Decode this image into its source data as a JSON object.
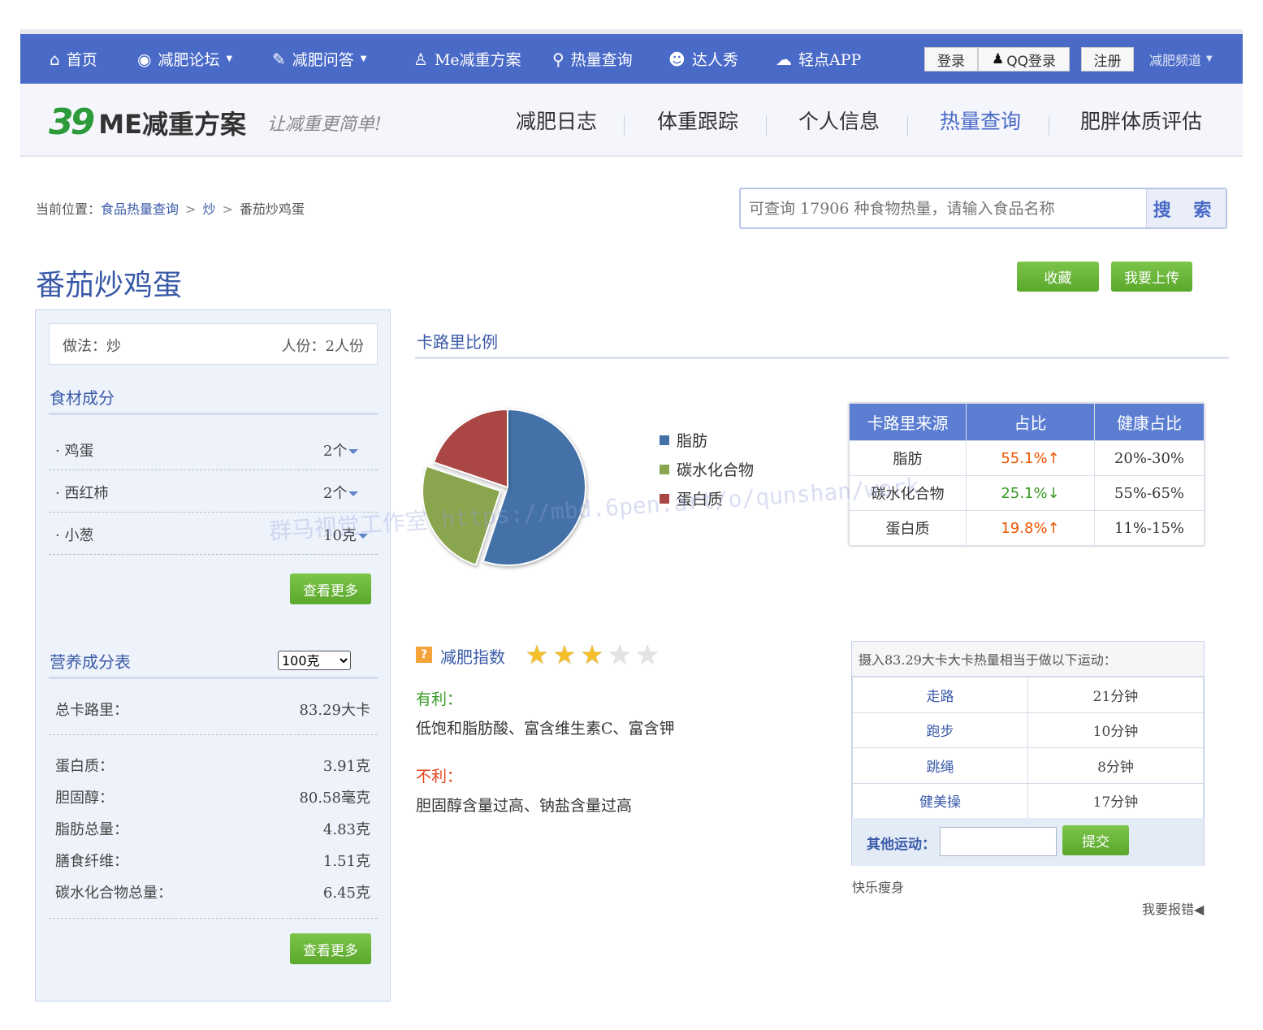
{
  "topnav": {
    "items": [
      {
        "label": "首页",
        "icon": "home-icon"
      },
      {
        "label": "减肥论坛",
        "icon": "forum-icon"
      },
      {
        "label": "减肥问答",
        "icon": "qa-icon"
      },
      {
        "label": "Me减重方案",
        "icon": "user-plan-icon"
      },
      {
        "label": "热量查询",
        "icon": "search-icon"
      },
      {
        "label": "达人秀",
        "icon": "people-icon"
      },
      {
        "label": "轻点APP",
        "icon": "app-icon"
      }
    ],
    "login": "登录",
    "qq_login": "QQ登录",
    "register": "注册",
    "channel": "减肥频道"
  },
  "subheader": {
    "logo_num": "39",
    "logo_brand": "ME减重方案",
    "slogan": "让减重更简单!",
    "nav": [
      "减肥日志",
      "体重跟踪",
      "个人信息",
      "热量查询",
      "肥胖体质评估"
    ],
    "active": "热量查询"
  },
  "breadcrumb": {
    "prefix": "当前位置：",
    "level1": "食品热量查询",
    "level2": "炒",
    "current": "番茄炒鸡蛋",
    "sep": ">"
  },
  "search": {
    "placeholder": "可查询 17906 种食物热量，请输入食品名称",
    "button": "搜 索"
  },
  "title": "番茄炒鸡蛋",
  "actions": {
    "collect": "收藏",
    "upload": "我要上传"
  },
  "recipe": {
    "method": "做法：炒",
    "servings": "人份：2人份",
    "ingredients_title": "食材成分",
    "ingredients": [
      {
        "name": "·  鸡蛋",
        "qty": "2个"
      },
      {
        "name": "·  西红柿",
        "qty": "2个"
      },
      {
        "name": "·  小葱",
        "qty": "10克"
      }
    ],
    "more": "查看更多"
  },
  "nutrition": {
    "title": "营养成分表",
    "unit": "100克",
    "total_label": "总卡路里：",
    "total_value": "83.29大卡",
    "rows": [
      {
        "label": "蛋白质：",
        "value": "3.91克"
      },
      {
        "label": "胆固醇：",
        "value": "80.58毫克"
      },
      {
        "label": "脂肪总量：",
        "value": "4.83克"
      },
      {
        "label": "膳食纤维：",
        "value": "1.51克"
      },
      {
        "label": "碳水化合物总量：",
        "value": "6.45克"
      }
    ],
    "more": "查看更多"
  },
  "calorie": {
    "title": "卡路里比例",
    "table_headers": [
      "卡路里来源",
      "占比",
      "健康占比"
    ],
    "rows": [
      {
        "source": "脂肪",
        "ratio": "55.1%",
        "arrow": "↑",
        "trend": "hi",
        "healthy": "20%-30%"
      },
      {
        "source": "碳水化合物",
        "ratio": "25.1%",
        "arrow": "↓",
        "trend": "lo",
        "healthy": "55%-65%"
      },
      {
        "source": "蛋白质",
        "ratio": "19.8%",
        "arrow": "↑",
        "trend": "hi",
        "healthy": "11%-15%"
      }
    ]
  },
  "chart_data": {
    "type": "pie",
    "labels": [
      "脂肪",
      "碳水化合物",
      "蛋白质"
    ],
    "values": [
      55.1,
      25.1,
      19.8
    ],
    "colors": [
      "#4472a8",
      "#89a54e",
      "#aa4643"
    ],
    "legend_position": "right"
  },
  "diet": {
    "label": "减肥指数",
    "stars_filled": 3,
    "stars_total": 5,
    "good_label": "有利：",
    "good_text": "低饱和脂肪酸、富含维生素C、富含钾",
    "bad_label": "不利：",
    "bad_text": "胆固醇含量过高、钠盐含量过高"
  },
  "exercise": {
    "header": "摄入83.29大卡大卡热量相当于做以下运动：",
    "rows": [
      {
        "name": "走路",
        "time": "21分钟"
      },
      {
        "name": "跑步",
        "time": "10分钟"
      },
      {
        "name": "跳绳",
        "time": "8分钟"
      },
      {
        "name": "健美操",
        "time": "17分钟"
      }
    ],
    "other_label": "其他运动：",
    "submit": "提交"
  },
  "happy": "快乐瘦身",
  "report": "我要报错",
  "watermark": "群马视觉工作室 https://mbd.6pen.art/o/qunshan/work",
  "colors": {
    "brand_blue": "#4a6ac8",
    "green": "#5aa82c",
    "up": "#ee5500",
    "down": "#3a9a26"
  }
}
